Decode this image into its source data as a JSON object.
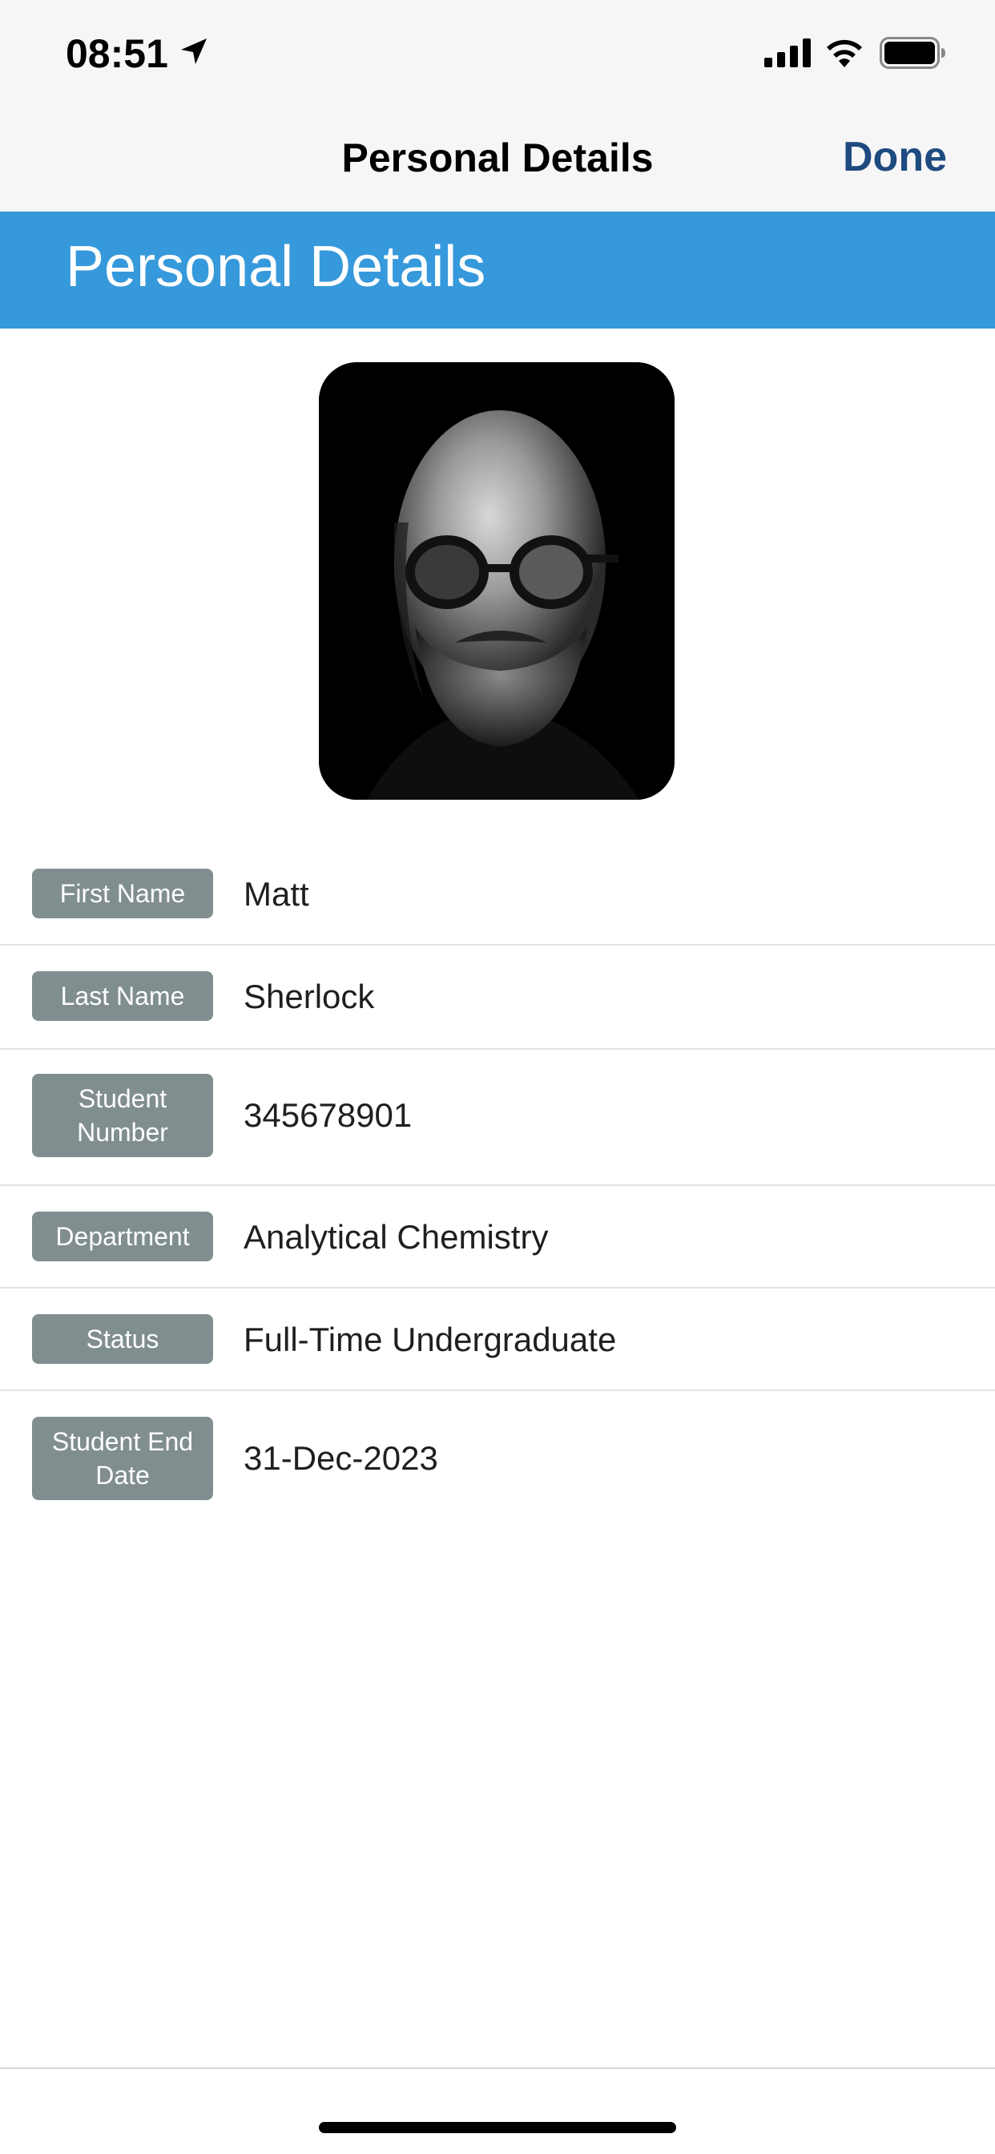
{
  "status_bar": {
    "time": "08:51",
    "icons": [
      "location-arrow-icon",
      "cellular-signal-icon",
      "wifi-icon",
      "battery-icon"
    ]
  },
  "nav": {
    "title": "Personal Details",
    "done_label": "Done"
  },
  "header": {
    "title": "Personal Details"
  },
  "profile": {
    "photo": "profile-photo"
  },
  "details": [
    {
      "label": "First Name",
      "value": "Matt"
    },
    {
      "label": "Last Name",
      "value": "Sherlock"
    },
    {
      "label": "Student Number",
      "value": "345678901"
    },
    {
      "label": "Department",
      "value": "Analytical Chemistry"
    },
    {
      "label": "Status",
      "value": "Full-Time Undergraduate"
    },
    {
      "label": "Student End Date",
      "value": "31-Dec-2023"
    }
  ],
  "colors": {
    "header_band": "#3699db",
    "label_badge": "#808e8f",
    "done_link": "#1e4a80"
  }
}
